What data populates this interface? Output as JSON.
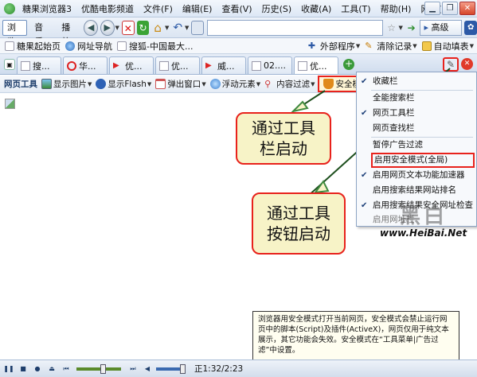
{
  "titlebar": {
    "app_title": "糖果浏览器3",
    "menu": [
      "优酷电影频道",
      "文件(F)",
      "编辑(E)",
      "查看(V)",
      "历史(S)",
      "收藏(A)",
      "工具(T)",
      "帮助(H)",
      "网址(U)"
    ],
    "minimize": "▁",
    "restore": "❐",
    "close": "✕"
  },
  "addressbar": {
    "modes": [
      "浏览",
      "音乐",
      "播放"
    ],
    "search_label": "高级",
    "url_value": ""
  },
  "favorites": {
    "items": [
      "糖果起始页",
      "网址导航",
      "搜狐-中国最大..."
    ],
    "external_programs": "外部程序",
    "clear_records": "清除记录",
    "auto_fill": "自动填表"
  },
  "tabs": {
    "items": [
      "搜...",
      "华...",
      "优...",
      "优...",
      "威...",
      "02....",
      "优..."
    ],
    "active_index": 6
  },
  "webtools": {
    "label": "网页工具",
    "items": [
      "显示图片",
      "显示Flash",
      "弹出窗口",
      "浮动元素",
      "内容过滤",
      "安全模式"
    ]
  },
  "dropdown": {
    "items": [
      {
        "label": "收藏栏",
        "checked": true
      },
      {
        "label": "全能搜索栏",
        "checked": false
      },
      {
        "label": "网页工具栏",
        "checked": true
      },
      {
        "label": "网页查找栏",
        "checked": false
      },
      {
        "label": "暂停广告过滤",
        "checked": false
      },
      {
        "label": "启用安全模式(全局)",
        "checked": false
      },
      {
        "label": "启用网页文本功能加速器",
        "checked": true
      },
      {
        "label": "启用搜索结果网站排名",
        "checked": false
      },
      {
        "label": "启用搜索结果安全网址检查",
        "checked": true
      },
      {
        "label": "启用网址栏",
        "checked": false
      }
    ]
  },
  "callouts": {
    "toolbar_start": "通过工具\n栏启动",
    "button_start": "通过工具\n按钮启动"
  },
  "tip": "浏览器用安全模式打开当前网页，安全模式会禁止运行网页中的脚本(Script)及插件(ActiveX)，网页仅用于纯文本展示，其它功能会失效。安全模式在“工具菜单|广告过滤”中设置。",
  "statusbar": {
    "time": "正1:32/2:23"
  },
  "watermark": {
    "text_cn": "黑白",
    "text_url": "www.HeiBai.Net"
  },
  "colors": {
    "highlight_red": "#e8221c",
    "callout_fill": "#f7f3c7",
    "callout_border": "#3f8a3f"
  }
}
